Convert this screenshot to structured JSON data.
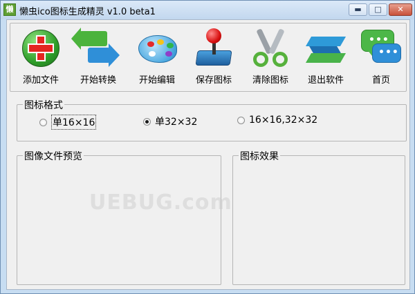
{
  "window": {
    "title": "懒虫ico图标生成精灵 v1.0 beta1",
    "app_icon_char": "懒",
    "controls": {
      "minimize": "▬",
      "maximize": "□",
      "close": "✕"
    }
  },
  "toolbar": {
    "items": [
      {
        "label": "添加文件",
        "icon": "add-file-icon"
      },
      {
        "label": "开始转换",
        "icon": "convert-arrows-icon"
      },
      {
        "label": "开始编辑",
        "icon": "palette-icon"
      },
      {
        "label": "保存图标",
        "icon": "joystick-icon"
      },
      {
        "label": "清除图标",
        "icon": "scissors-icon"
      },
      {
        "label": "退出软件",
        "icon": "exit-icon"
      },
      {
        "label": "首页",
        "icon": "chat-bubbles-icon"
      }
    ]
  },
  "format_group": {
    "title": "图标格式",
    "options": [
      {
        "label": "单16×16",
        "checked": false
      },
      {
        "label": "单32×32",
        "checked": true
      },
      {
        "label": "16×16,32×32",
        "checked": false
      }
    ]
  },
  "preview_group": {
    "title": "图像文件预览",
    "watermark": "UEBUG.com"
  },
  "effect_group": {
    "title": "图标效果"
  }
}
